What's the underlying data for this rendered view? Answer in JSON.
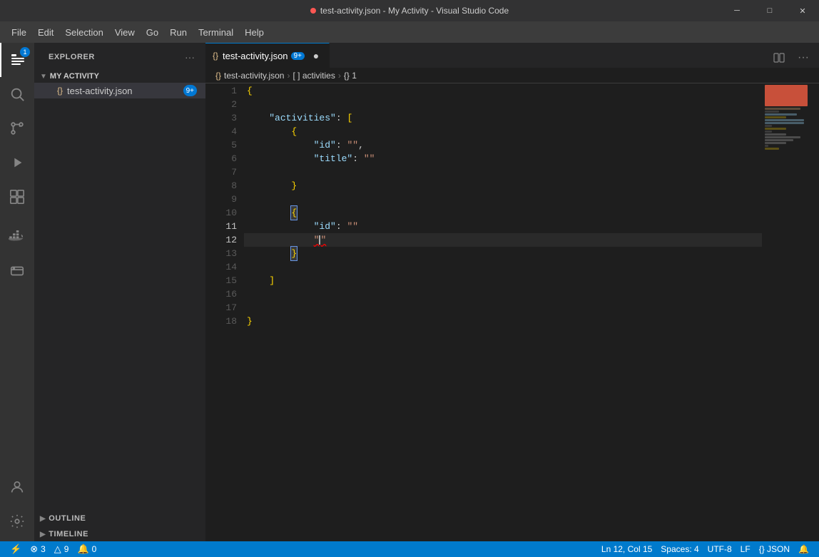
{
  "window": {
    "title": "test-activity.json - My Activity - Visual Studio Code",
    "dot_color": "#fc5753"
  },
  "titlebar": {
    "title": "test-activity.json - My Activity - Visual Studio Code",
    "minimize": "─",
    "maximize": "□",
    "close": "✕"
  },
  "menubar": {
    "items": [
      "File",
      "Edit",
      "Selection",
      "View",
      "Go",
      "Run",
      "Terminal",
      "Help"
    ]
  },
  "activity_bar": {
    "icons": [
      {
        "name": "explorer-icon",
        "symbol": "⎘",
        "active": true,
        "badge": "1"
      },
      {
        "name": "search-icon",
        "symbol": "🔍",
        "active": false
      },
      {
        "name": "source-control-icon",
        "symbol": "⑂",
        "active": false
      },
      {
        "name": "run-debug-icon",
        "symbol": "▷",
        "active": false
      },
      {
        "name": "extensions-icon",
        "symbol": "⊞",
        "active": false
      },
      {
        "name": "docker-icon",
        "symbol": "🐳",
        "active": false
      },
      {
        "name": "remote-explorer-icon",
        "symbol": "⬡",
        "active": false
      }
    ],
    "bottom_icons": [
      {
        "name": "accounts-icon",
        "symbol": "👤"
      },
      {
        "name": "settings-icon",
        "symbol": "⚙"
      }
    ]
  },
  "sidebar": {
    "title": "EXPLORER",
    "actions_icon": "···",
    "folder": {
      "name": "MY ACTIVITY",
      "expanded": true
    },
    "files": [
      {
        "name": "test-activity.json",
        "badge": "9+",
        "active": true
      }
    ],
    "outline_section": "OUTLINE",
    "timeline_section": "TIMELINE"
  },
  "editor": {
    "tab": {
      "filename": "test-activity.json",
      "badge": "9+",
      "modified": true
    },
    "breadcrumb": [
      {
        "text": "test-activity.json",
        "icon": "{}"
      },
      {
        "text": "[ ] activities",
        "icon": ""
      },
      {
        "text": "{} 1",
        "icon": ""
      }
    ],
    "lines": [
      {
        "num": 1,
        "content": "{",
        "indent": 0,
        "parts": [
          {
            "type": "brace",
            "text": "{"
          }
        ]
      },
      {
        "num": 2,
        "content": "",
        "indent": 0,
        "parts": []
      },
      {
        "num": 3,
        "content": "    \"activities\": [",
        "indent": 4,
        "parts": [
          {
            "type": "indent",
            "spaces": "    "
          },
          {
            "type": "key",
            "text": "\"activities\""
          },
          {
            "type": "colon",
            "text": ": "
          },
          {
            "type": "bracket",
            "text": "["
          }
        ]
      },
      {
        "num": 4,
        "content": "        {",
        "indent": 8,
        "parts": [
          {
            "type": "indent",
            "spaces": "        "
          },
          {
            "type": "brace",
            "text": "{"
          }
        ]
      },
      {
        "num": 5,
        "content": "            \"id\": \"\",",
        "indent": 12,
        "parts": [
          {
            "type": "indent",
            "spaces": "            "
          },
          {
            "type": "key",
            "text": "\"id\""
          },
          {
            "type": "colon",
            "text": ": "
          },
          {
            "type": "string",
            "text": "\"\""
          },
          {
            "type": "punct",
            "text": ","
          }
        ]
      },
      {
        "num": 6,
        "content": "            \"title\": \"\"",
        "indent": 12,
        "parts": [
          {
            "type": "indent",
            "spaces": "            "
          },
          {
            "type": "key",
            "text": "\"title\""
          },
          {
            "type": "colon",
            "text": ": "
          },
          {
            "type": "string",
            "text": "\"\""
          }
        ]
      },
      {
        "num": 7,
        "content": "",
        "indent": 0,
        "parts": []
      },
      {
        "num": 8,
        "content": "        }",
        "indent": 8,
        "parts": [
          {
            "type": "indent",
            "spaces": "        "
          },
          {
            "type": "brace",
            "text": "}"
          }
        ]
      },
      {
        "num": 9,
        "content": "",
        "indent": 0,
        "parts": []
      },
      {
        "num": 10,
        "content": "        {",
        "indent": 8,
        "parts": [
          {
            "type": "indent",
            "spaces": "        "
          },
          {
            "type": "brace",
            "text": "{"
          }
        ]
      },
      {
        "num": 11,
        "content": "            \"id\": \"\"",
        "indent": 12,
        "parts": [
          {
            "type": "indent",
            "spaces": "            "
          },
          {
            "type": "key",
            "text": "\"id\""
          },
          {
            "type": "colon",
            "text": ": "
          },
          {
            "type": "string",
            "text": "\"\""
          }
        ]
      },
      {
        "num": 12,
        "content": "            \"\"",
        "indent": 12,
        "current": true,
        "parts": [
          {
            "type": "indent",
            "spaces": "            "
          },
          {
            "type": "string",
            "text": "\"\"",
            "squig": true
          }
        ]
      },
      {
        "num": 13,
        "content": "        }",
        "indent": 8,
        "parts": [
          {
            "type": "indent",
            "spaces": "        "
          },
          {
            "type": "brace",
            "text": "}"
          }
        ]
      },
      {
        "num": 14,
        "content": "",
        "indent": 0,
        "parts": []
      },
      {
        "num": 15,
        "content": "    ]",
        "indent": 4,
        "parts": [
          {
            "type": "indent",
            "spaces": "    "
          },
          {
            "type": "bracket",
            "text": "]"
          }
        ]
      },
      {
        "num": 16,
        "content": "",
        "indent": 0,
        "parts": []
      },
      {
        "num": 17,
        "content": "",
        "indent": 0,
        "parts": []
      },
      {
        "num": 18,
        "content": "}",
        "indent": 0,
        "parts": [
          {
            "type": "brace",
            "text": "}"
          }
        ]
      }
    ]
  },
  "status_bar": {
    "left": [
      {
        "icon": "⚡",
        "text": "",
        "name": "remote-status"
      },
      {
        "icon": "⊗",
        "text": "3",
        "name": "errors-status"
      },
      {
        "icon": "△",
        "text": "9",
        "name": "warnings-status"
      },
      {
        "icon": "🔔",
        "text": "0",
        "name": "notifications-status"
      }
    ],
    "right": [
      {
        "text": "Ln 12, Col 15",
        "name": "cursor-position"
      },
      {
        "text": "Spaces: 4",
        "name": "indent-status"
      },
      {
        "text": "UTF-8",
        "name": "encoding-status"
      },
      {
        "text": "LF",
        "name": "eol-status"
      },
      {
        "text": "{} JSON",
        "name": "language-status"
      },
      {
        "icon": "🔔",
        "text": "",
        "name": "bell-status"
      }
    ]
  }
}
